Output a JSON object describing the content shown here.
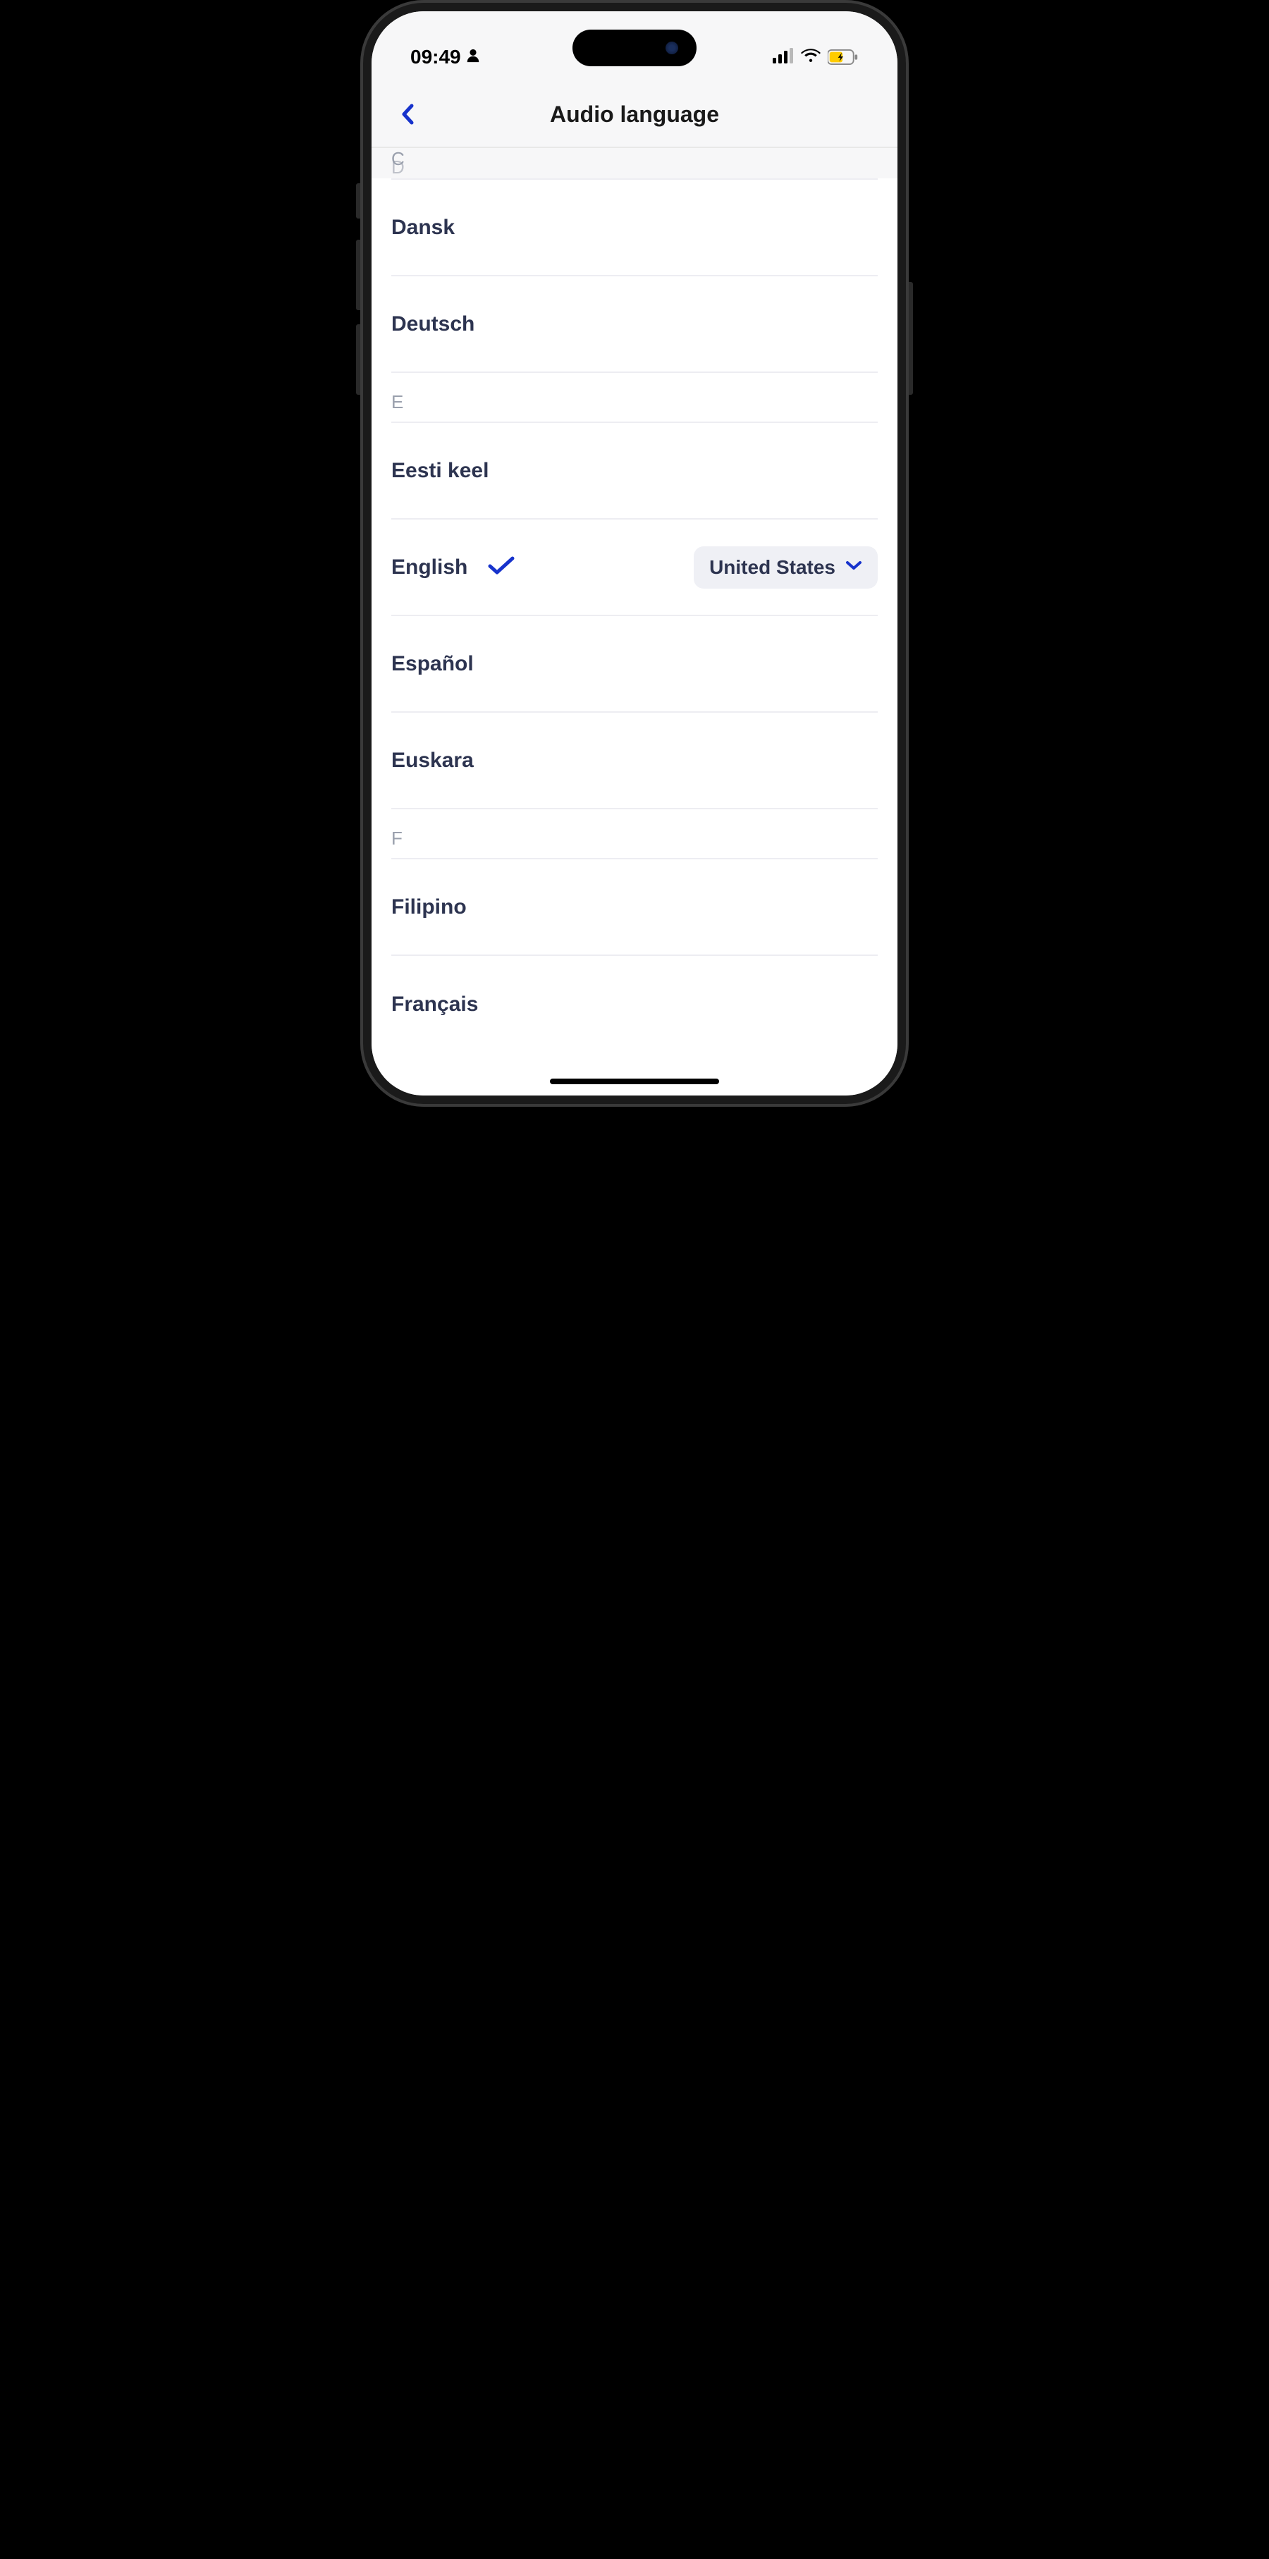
{
  "status_bar": {
    "time": "09:49"
  },
  "header": {
    "title": "Audio language"
  },
  "visible_section_letter_top": "C",
  "visible_section_letter_peek": "D",
  "languages": [
    {
      "section": null,
      "name": "Dansk",
      "selected": false
    },
    {
      "section": null,
      "name": "Deutsch",
      "selected": false
    },
    {
      "section": "E",
      "name": "Eesti keel",
      "selected": false
    },
    {
      "section": null,
      "name": "English",
      "selected": true,
      "region": "United States"
    },
    {
      "section": null,
      "name": "Español",
      "selected": false
    },
    {
      "section": null,
      "name": "Euskara",
      "selected": false
    },
    {
      "section": "F",
      "name": "Filipino",
      "selected": false
    },
    {
      "section": null,
      "name": "Français",
      "selected": false
    }
  ]
}
